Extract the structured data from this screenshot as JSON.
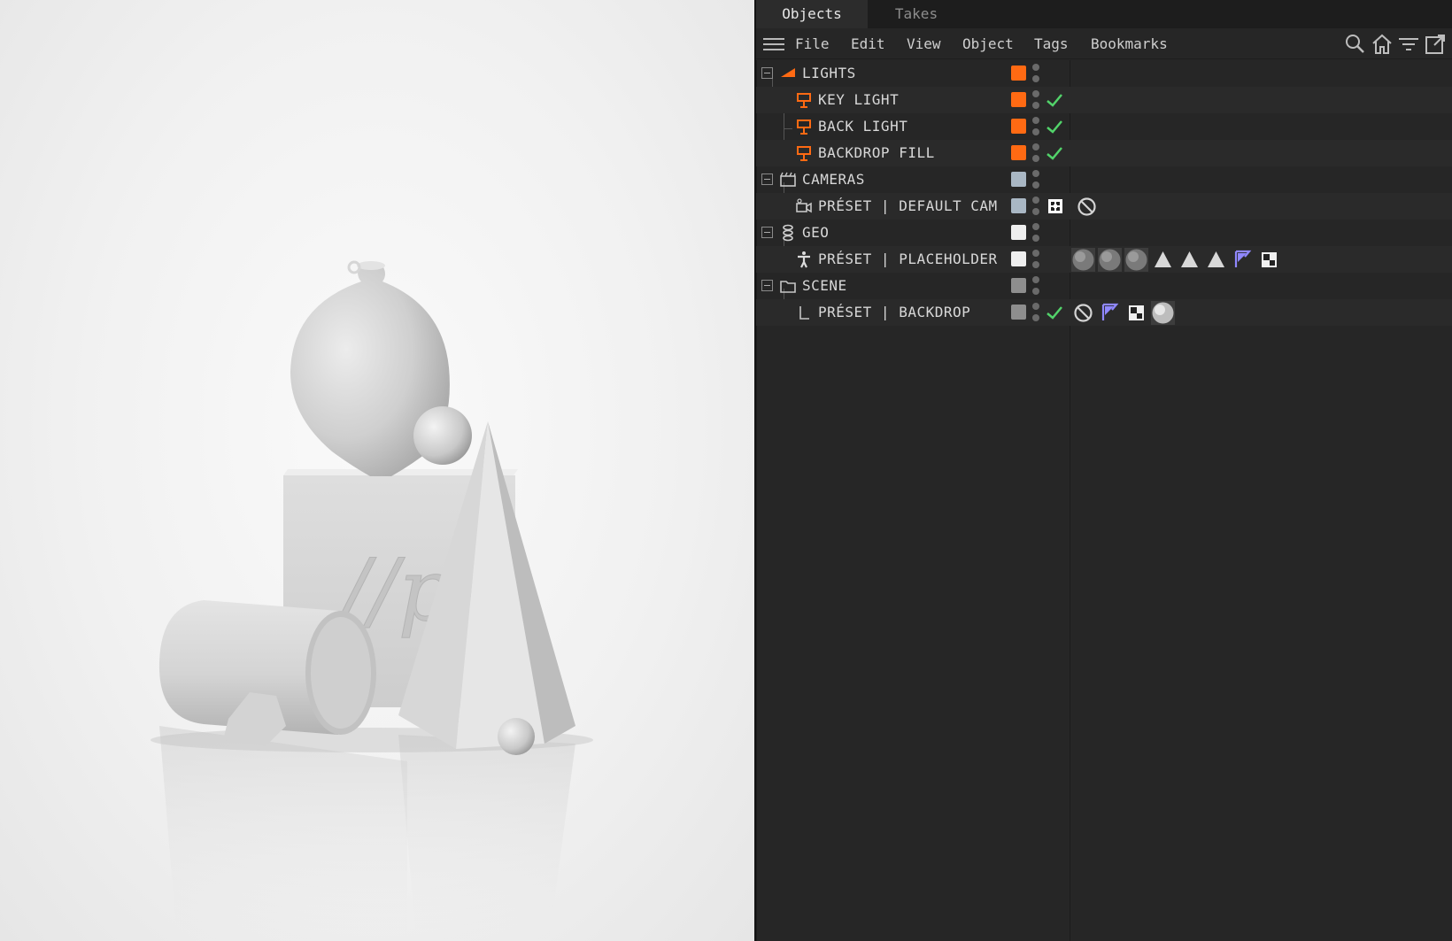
{
  "tabs": {
    "objects": "Objects",
    "takes": "Takes"
  },
  "menu": {
    "file": "File",
    "edit": "Edit",
    "view": "View",
    "object": "Object",
    "tags": "Tags",
    "bookmarks": "Bookmarks"
  },
  "toolbar_icons": [
    "search-icon",
    "home-icon",
    "filter-icon",
    "new-window-icon"
  ],
  "colors": {
    "orange": "#ff6a13",
    "light_blue": "#a9b7c4",
    "white": "#eeeeee",
    "gray": "#8e8e8e",
    "check_green": "#52d36a",
    "tag_purple": "#8f87ff"
  },
  "tree": {
    "lights": {
      "label": "LIGHTS",
      "icon": "light-group-icon",
      "color": "orange"
    },
    "key_light": {
      "label": "KEY LIGHT",
      "icon": "area-light-icon",
      "color": "orange"
    },
    "back_light": {
      "label": "BACK LIGHT",
      "icon": "area-light-icon",
      "color": "orange"
    },
    "backdrop_fill": {
      "label": "BACKDROP FILL",
      "icon": "area-light-icon",
      "color": "orange"
    },
    "cameras": {
      "label": "CAMERAS",
      "icon": "clapper-icon",
      "color": "light_blue"
    },
    "default_cam": {
      "label": "PRÉSET | DEFAULT CAM",
      "icon": "camera-icon",
      "color": "light_blue",
      "tags": [
        "target-tag-icon",
        "protection-tag-icon"
      ]
    },
    "geo": {
      "label": "GEO",
      "icon": "null-group-icon",
      "color": "white"
    },
    "placeholder": {
      "label": "PRÉSET | PLACEHOLDER",
      "icon": "figure-icon",
      "color": "white",
      "tags": [
        "material-sphere-icon",
        "material-sphere-icon",
        "material-sphere-icon",
        "phong-tag-icon",
        "phong-tag-icon",
        "phong-tag-icon",
        "selection-tag-icon",
        "uvw-tag-icon"
      ]
    },
    "scene": {
      "label": "SCENE",
      "icon": "folder-icon",
      "color": "gray"
    },
    "backdrop": {
      "label": "PRÉSET | BACKDROP",
      "icon": "floor-icon",
      "color": "gray",
      "tags": [
        "protection-tag-icon",
        "selection-tag-icon",
        "uvw-tag-icon",
        "material-sphere-icon"
      ]
    }
  },
  "viewport": {
    "embossed_text": "//pr"
  }
}
